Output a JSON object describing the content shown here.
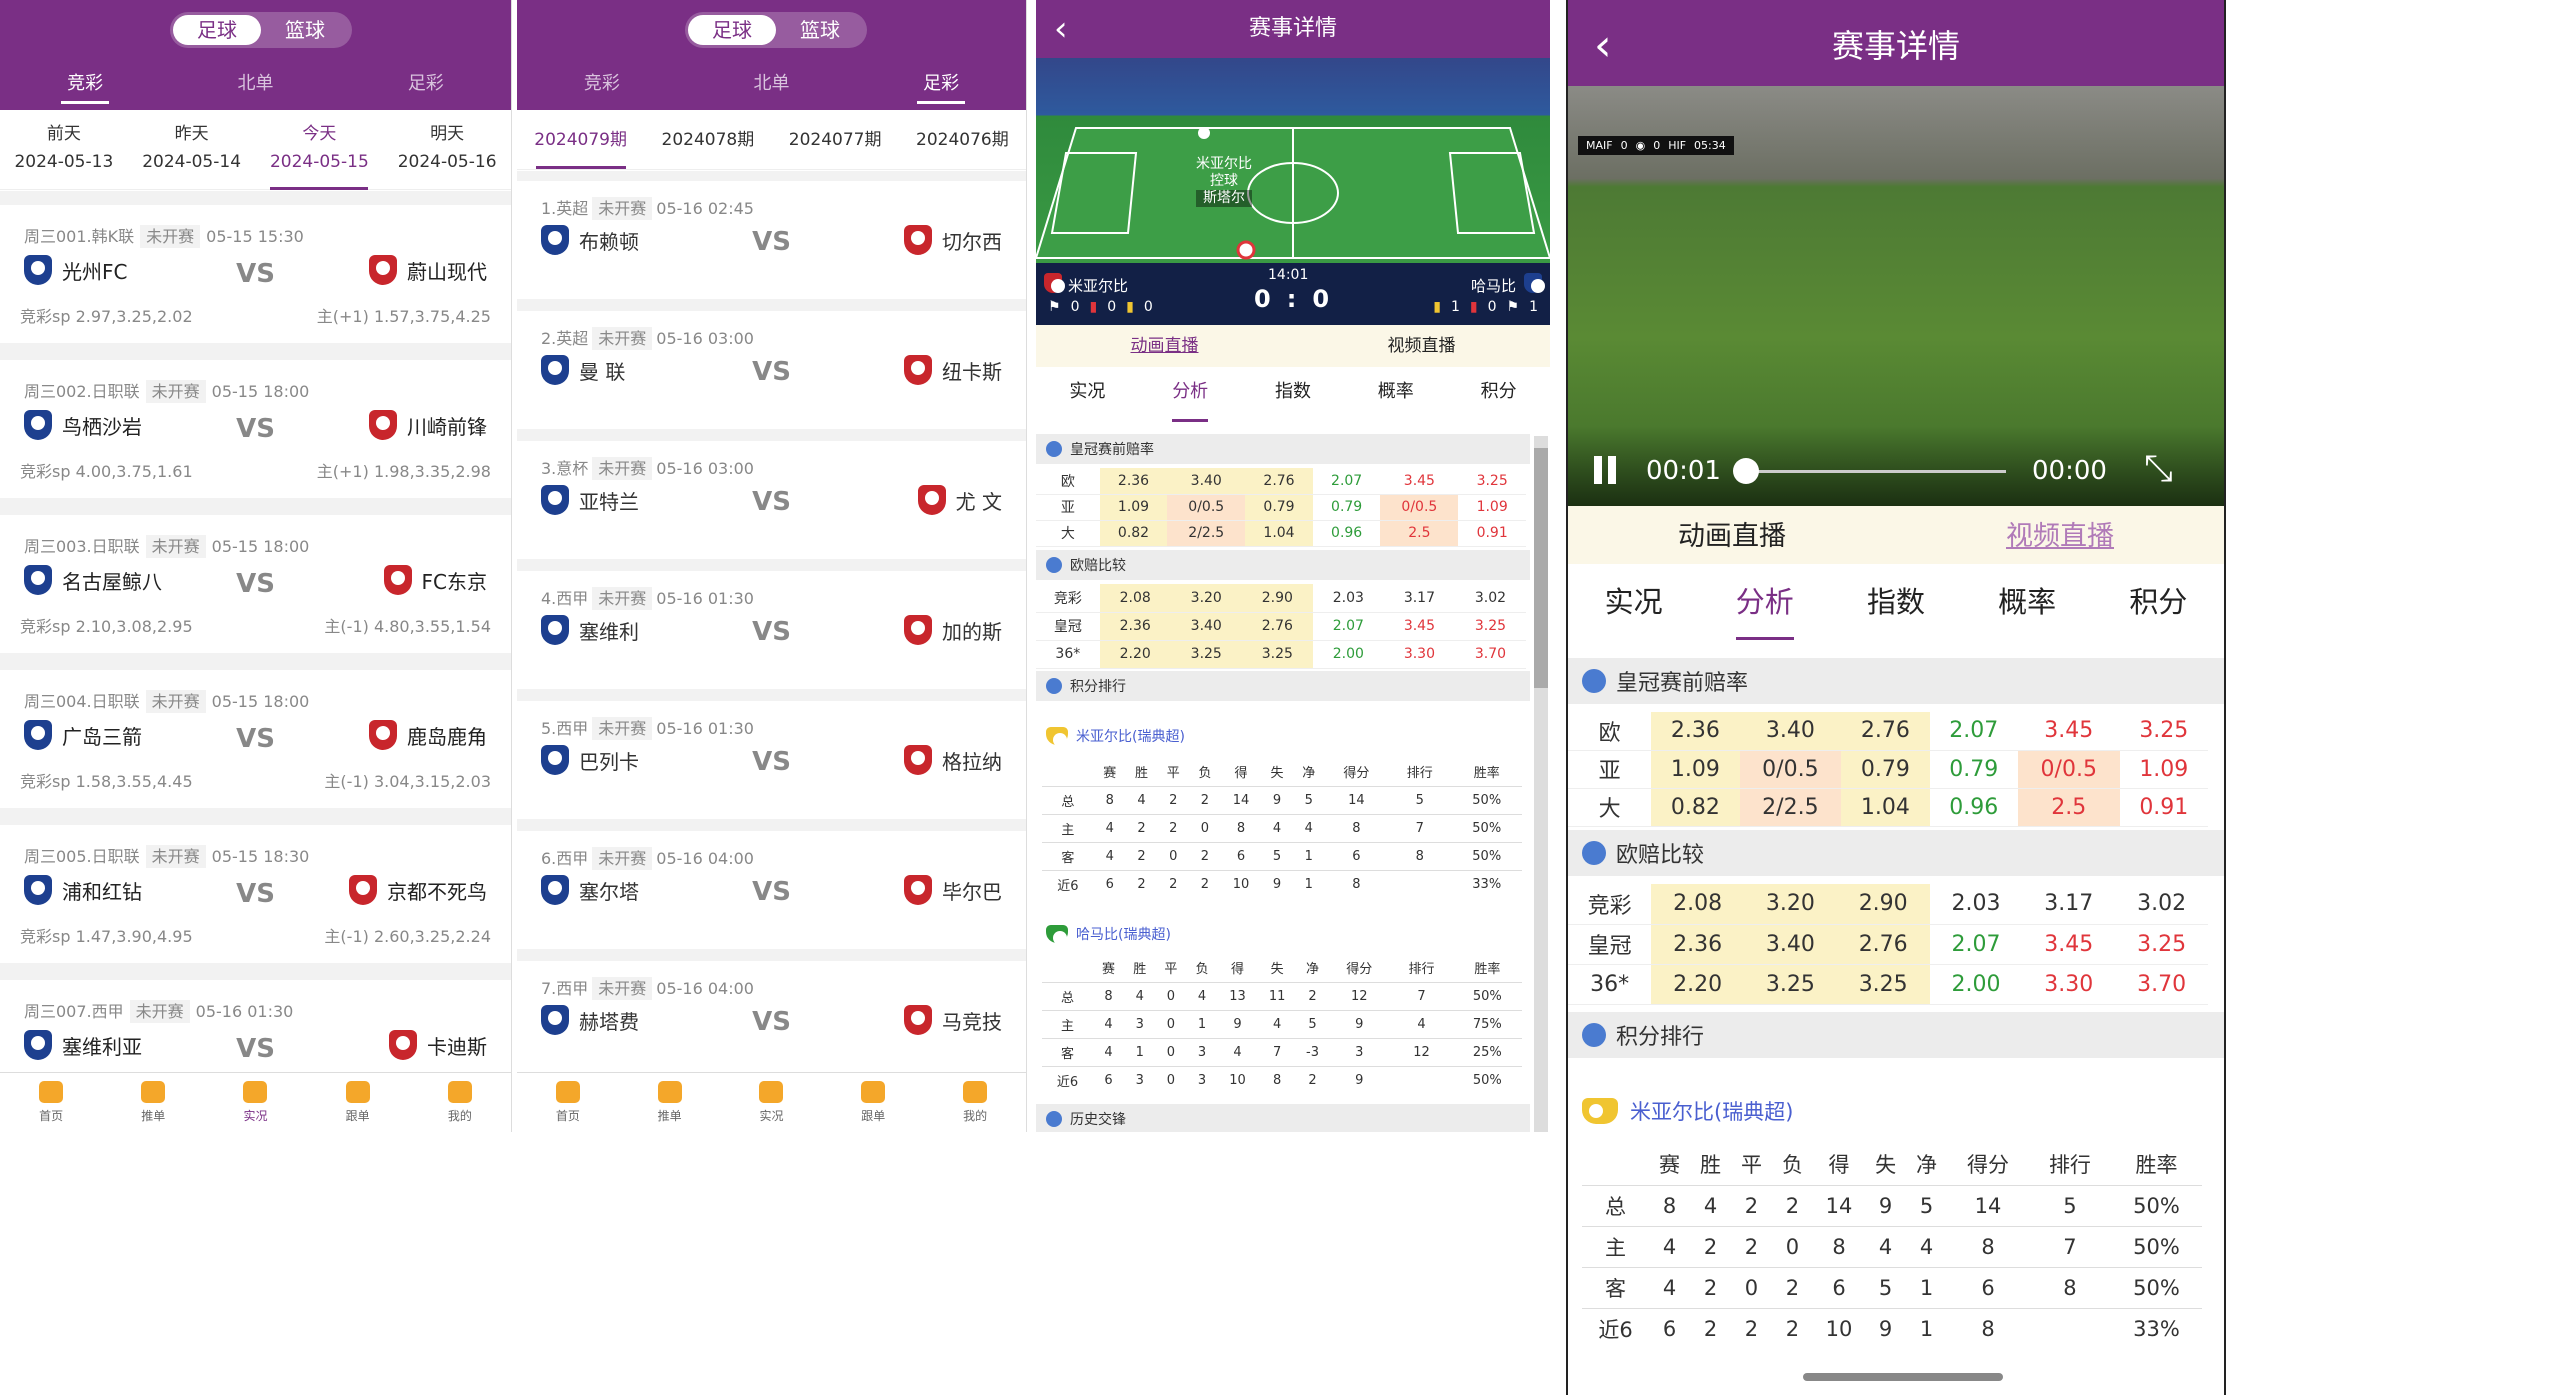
{
  "p1": {
    "seg": [
      "足球",
      "篮球"
    ],
    "tabs": [
      "竞彩",
      "北单",
      "足彩"
    ],
    "dates": [
      {
        "d": "前天",
        "v": "2024-05-13"
      },
      {
        "d": "昨天",
        "v": "2024-05-14"
      },
      {
        "d": "今天",
        "v": "2024-05-15"
      },
      {
        "d": "明天",
        "v": "2024-05-16"
      }
    ],
    "matches": [
      {
        "no": "周三001.韩K联",
        "status": "未开赛",
        "time": "05-15 15:30",
        "home": "光州FC",
        "away": "蔚山现代",
        "sl": "竞彩sp 2.97,3.25,2.02",
        "sr": "主(+1) 1.57,3.75,4.25"
      },
      {
        "no": "周三002.日职联",
        "status": "未开赛",
        "time": "05-15 18:00",
        "home": "鸟栖沙岩",
        "away": "川崎前锋",
        "sl": "竞彩sp 4.00,3.75,1.61",
        "sr": "主(+1) 1.98,3.35,2.98"
      },
      {
        "no": "周三003.日职联",
        "status": "未开赛",
        "time": "05-15 18:00",
        "home": "名古屋鲸八",
        "away": "FC东京",
        "sl": "竞彩sp 2.10,3.08,2.95",
        "sr": "主(-1) 4.80,3.55,1.54"
      },
      {
        "no": "周三004.日职联",
        "status": "未开赛",
        "time": "05-15 18:00",
        "home": "广岛三箭",
        "away": "鹿岛鹿角",
        "sl": "竞彩sp 1.58,3.55,4.45",
        "sr": "主(-1) 3.04,3.15,2.03"
      },
      {
        "no": "周三005.日职联",
        "status": "未开赛",
        "time": "05-15 18:30",
        "home": "浦和红钻",
        "away": "京都不死鸟",
        "sl": "竞彩sp 1.47,3.90,4.95",
        "sr": "主(-1) 2.60,3.25,2.24"
      },
      {
        "no": "周三007.西甲",
        "status": "未开赛",
        "time": "05-16 01:30",
        "home": "塞维利亚",
        "away": "卡迪斯",
        "sl": "",
        "sr": ""
      }
    ],
    "vs": "VS"
  },
  "p2": {
    "seg": [
      "足球",
      "篮球"
    ],
    "tabs": [
      "竞彩",
      "北单",
      "足彩"
    ],
    "issues": [
      "2024079期",
      "2024078期",
      "2024077期",
      "2024076期"
    ],
    "matches": [
      {
        "no": "1.英超",
        "status": "未开赛",
        "time": "05-16 02:45",
        "home": "布赖顿",
        "away": "切尔西"
      },
      {
        "no": "2.英超",
        "status": "未开赛",
        "time": "05-16 03:00",
        "home": "曼 联",
        "away": "纽卡斯"
      },
      {
        "no": "3.意杯",
        "status": "未开赛",
        "time": "05-16 03:00",
        "home": "亚特兰",
        "away": "尤 文"
      },
      {
        "no": "4.西甲",
        "status": "未开赛",
        "time": "05-16 01:30",
        "home": "塞维利",
        "away": "加的斯"
      },
      {
        "no": "5.西甲",
        "status": "未开赛",
        "time": "05-16 01:30",
        "home": "巴列卡",
        "away": "格拉纳"
      },
      {
        "no": "6.西甲",
        "status": "未开赛",
        "time": "05-16 04:00",
        "home": "塞尔塔",
        "away": "毕尔巴"
      },
      {
        "no": "7.西甲",
        "status": "未开赛",
        "time": "05-16 04:00",
        "home": "赫塔费",
        "away": "马竞技"
      }
    ]
  },
  "tabbar": [
    "首页",
    "推单",
    "实况",
    "跟单",
    "我的"
  ],
  "detail": {
    "title": "赛事详情",
    "home": "米亚尔比",
    "away": "哈马比",
    "time": "14:01",
    "score_h": "0",
    "score_a": "0",
    "pitch_label1": "米亚尔比",
    "pitch_label2": "控球",
    "pitch_label3": "斯塔尔",
    "home_stats": [
      "0",
      "0",
      "0"
    ],
    "away_stats": [
      "1",
      "0",
      "1"
    ],
    "live_tabs": [
      "动画直播",
      "视频直播"
    ],
    "tabs": [
      "实况",
      "分析",
      "指数",
      "概率",
      "积分"
    ],
    "sec_odds": "皇冠赛前赔率",
    "sec_euro": "欧赔比较",
    "sec_rank": "积分排行",
    "sec_h2h": "历史交锋",
    "odds": [
      {
        "k": "欧",
        "v": [
          "2.36",
          "3.40",
          "2.76",
          "2.07",
          "3.45",
          "3.25"
        ]
      },
      {
        "k": "亚",
        "v": [
          "1.09",
          "0/0.5",
          "0.79",
          "0.79",
          "0/0.5",
          "1.09"
        ]
      },
      {
        "k": "大",
        "v": [
          "0.82",
          "2/2.5",
          "1.04",
          "0.96",
          "2.5",
          "0.91"
        ]
      }
    ],
    "euro": [
      {
        "k": "竞彩",
        "v": [
          "2.08",
          "3.20",
          "2.90",
          "2.03",
          "3.17",
          "3.02"
        ]
      },
      {
        "k": "皇冠",
        "v": [
          "2.36",
          "3.40",
          "2.76",
          "2.07",
          "3.45",
          "3.25"
        ]
      },
      {
        "k": "36*",
        "v": [
          "2.20",
          "3.25",
          "3.25",
          "2.00",
          "3.30",
          "3.70"
        ]
      }
    ],
    "stat_head": [
      "赛",
      "胜",
      "平",
      "负",
      "得",
      "失",
      "净",
      "得分",
      "排行",
      "胜率"
    ],
    "team1": "米亚尔比(瑞典超)",
    "team1_rows": [
      {
        "k": "总",
        "v": [
          "8",
          "4",
          "2",
          "2",
          "14",
          "9",
          "5",
          "14",
          "5",
          "50%"
        ]
      },
      {
        "k": "主",
        "v": [
          "4",
          "2",
          "2",
          "0",
          "8",
          "4",
          "4",
          "8",
          "7",
          "50%"
        ]
      },
      {
        "k": "客",
        "v": [
          "4",
          "2",
          "0",
          "2",
          "6",
          "5",
          "1",
          "6",
          "8",
          "50%"
        ]
      },
      {
        "k": "近6",
        "v": [
          "6",
          "2",
          "2",
          "2",
          "10",
          "9",
          "1",
          "8",
          "",
          "33%"
        ]
      }
    ],
    "team2": "哈马比(瑞典超)",
    "team2_rows": [
      {
        "k": "总",
        "v": [
          "8",
          "4",
          "0",
          "4",
          "13",
          "11",
          "2",
          "12",
          "7",
          "50%"
        ]
      },
      {
        "k": "主",
        "v": [
          "4",
          "3",
          "0",
          "1",
          "9",
          "4",
          "5",
          "9",
          "4",
          "75%"
        ]
      },
      {
        "k": "客",
        "v": [
          "4",
          "1",
          "0",
          "3",
          "4",
          "7",
          "-3",
          "3",
          "12",
          "25%"
        ]
      },
      {
        "k": "近6",
        "v": [
          "6",
          "3",
          "0",
          "3",
          "10",
          "8",
          "2",
          "9",
          "",
          "50%"
        ]
      }
    ]
  },
  "video": {
    "title": "赛事详情",
    "t_now": "00:01",
    "t_total": "00:00",
    "progress": 0.0,
    "hud_home": "MAIF",
    "hud_score": "0",
    "hud_away": "HIF",
    "hud_time": "05:34",
    "live_tabs": [
      "动画直播",
      "视频直播"
    ],
    "tabs": [
      "实况",
      "分析",
      "指数",
      "概率",
      "积分"
    ]
  }
}
